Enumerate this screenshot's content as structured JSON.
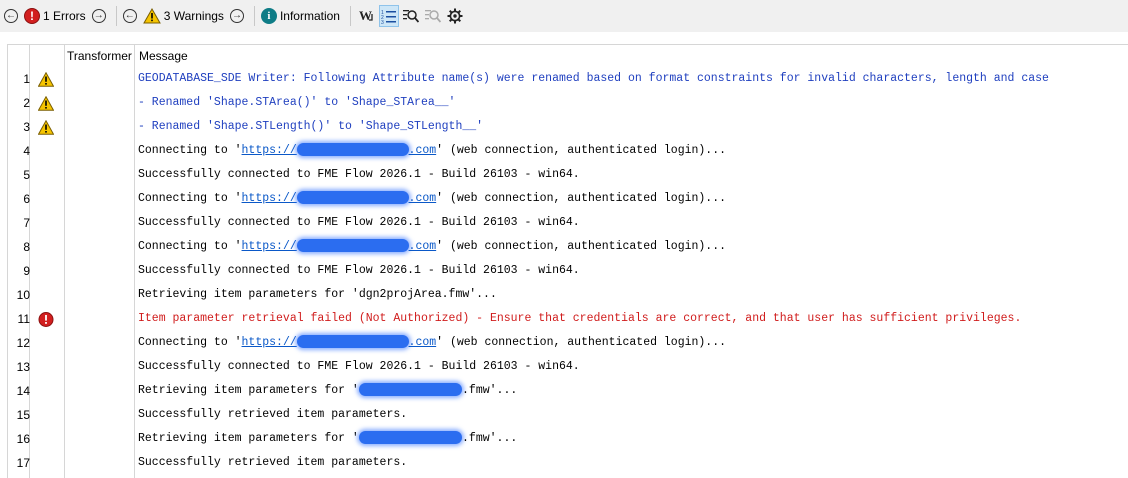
{
  "toolbar": {
    "errors_label": "1 Errors",
    "warnings_label": "3 Warnings",
    "information_label": "Information",
    "colors": {
      "error": "#d21f1f",
      "warning": "#f5c400",
      "info": "#0e7c86"
    }
  },
  "columns": {
    "transformer": "Transformer",
    "message": "Message"
  },
  "rows": [
    {
      "num": "1",
      "severity": "warning",
      "parts": [
        {
          "t": "GEODATABASE_SDE Writer: Following Attribute name(s) were renamed based on format constraints for invalid characters, length and case"
        }
      ]
    },
    {
      "num": "2",
      "severity": "warning",
      "parts": [
        {
          "t": "- Renamed 'Shape.STArea()' to 'Shape_STArea__'"
        }
      ]
    },
    {
      "num": "3",
      "severity": "warning",
      "parts": [
        {
          "t": "- Renamed 'Shape.STLength()' to 'Shape_STLength__'"
        }
      ]
    },
    {
      "num": "4",
      "severity": "none",
      "parts": [
        {
          "t": "Connecting to '"
        },
        {
          "t": "https://",
          "url": true
        },
        {
          "blur": 13
        },
        {
          "t": ".com",
          "url": true
        },
        {
          "t": "' (web connection, authenticated login)..."
        }
      ]
    },
    {
      "num": "5",
      "severity": "none",
      "parts": [
        {
          "t": "Successfully connected to FME Flow 2026.1 - Build 26103 - win64."
        }
      ]
    },
    {
      "num": "6",
      "severity": "none",
      "parts": [
        {
          "t": "Connecting to '"
        },
        {
          "t": "https://",
          "url": true
        },
        {
          "blur": 13
        },
        {
          "t": ".com",
          "url": true
        },
        {
          "t": "' (web connection, authenticated login)..."
        }
      ]
    },
    {
      "num": "7",
      "severity": "none",
      "parts": [
        {
          "t": "Successfully connected to FME Flow 2026.1 - Build 26103 - win64."
        }
      ]
    },
    {
      "num": "8",
      "severity": "none",
      "parts": [
        {
          "t": "Connecting to '"
        },
        {
          "t": "https://",
          "url": true
        },
        {
          "blur": 13
        },
        {
          "t": ".com",
          "url": true
        },
        {
          "t": "' (web connection, authenticated login)..."
        }
      ]
    },
    {
      "num": "9",
      "severity": "none",
      "parts": [
        {
          "t": "Successfully connected to FME Flow 2026.1 - Build 26103 - win64."
        }
      ]
    },
    {
      "num": "10",
      "severity": "none",
      "parts": [
        {
          "t": "Retrieving item parameters for 'dgn2projArea.fmw'..."
        }
      ]
    },
    {
      "num": "11",
      "severity": "error",
      "parts": [
        {
          "t": "Item parameter retrieval failed (Not Authorized) - Ensure that credentials are correct, and that user has sufficient privileges."
        }
      ]
    },
    {
      "num": "12",
      "severity": "none",
      "parts": [
        {
          "t": "Connecting to '"
        },
        {
          "t": "https://",
          "url": true
        },
        {
          "blur": 13
        },
        {
          "t": ".com",
          "url": true
        },
        {
          "t": "' (web connection, authenticated login)..."
        }
      ]
    },
    {
      "num": "13",
      "severity": "none",
      "parts": [
        {
          "t": "Successfully connected to FME Flow 2026.1 - Build 26103 - win64."
        }
      ]
    },
    {
      "num": "14",
      "severity": "none",
      "parts": [
        {
          "t": "Retrieving item parameters for '"
        },
        {
          "blur": 12
        },
        {
          "t": ".fmw'..."
        }
      ]
    },
    {
      "num": "15",
      "severity": "none",
      "parts": [
        {
          "t": "Successfully retrieved item parameters."
        }
      ]
    },
    {
      "num": "16",
      "severity": "none",
      "parts": [
        {
          "t": "Retrieving item parameters for '"
        },
        {
          "blur": 12
        },
        {
          "t": ".fmw'..."
        }
      ]
    },
    {
      "num": "17",
      "severity": "none",
      "parts": [
        {
          "t": "Successfully retrieved item parameters."
        }
      ]
    }
  ]
}
